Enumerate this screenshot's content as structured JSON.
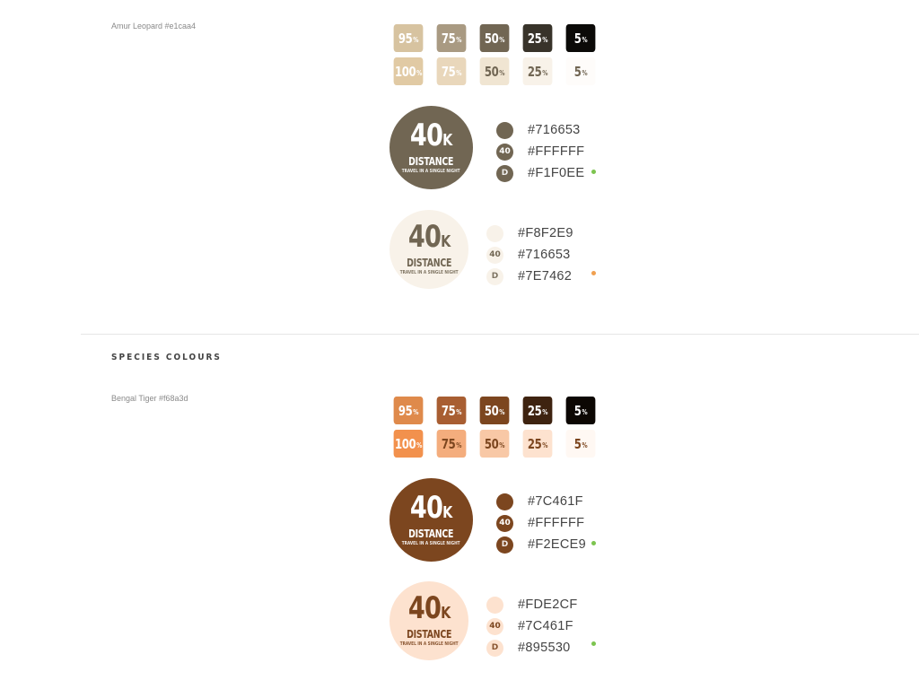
{
  "leopard": {
    "label": "Amur Leopard #e1caa4",
    "dark_swatches": [
      {
        "value": "95",
        "unit": "%",
        "bg": "#d7c3a0",
        "fg": "#ffffff"
      },
      {
        "value": "75",
        "unit": "%",
        "bg": "#a99a82",
        "fg": "#ffffff"
      },
      {
        "value": "50",
        "unit": "%",
        "bg": "#716653",
        "fg": "#ffffff"
      },
      {
        "value": "25",
        "unit": "%",
        "bg": "#38332a",
        "fg": "#ffffff"
      },
      {
        "value": "5",
        "unit": "%",
        "bg": "#0b0a08",
        "fg": "#ffffff"
      }
    ],
    "light_swatches": [
      {
        "value": "100",
        "unit": "%",
        "bg": "#e1caa4",
        "fg": "#ffffff"
      },
      {
        "value": "75",
        "unit": "%",
        "bg": "#e9d7bb",
        "fg": "#ffffff"
      },
      {
        "value": "50",
        "unit": "%",
        "bg": "#f0e5d2",
        "fg": "#716653"
      },
      {
        "value": "25",
        "unit": "%",
        "bg": "#f8f2e9",
        "fg": "#716653"
      },
      {
        "value": "5",
        "unit": "%",
        "bg": "#fefcfa",
        "fg": "#716653"
      }
    ],
    "badge_dark": {
      "number": "40",
      "suffix": "K",
      "title": "DISTANCE",
      "subtitle": "TRAVEL IN A SINGLE NIGHT",
      "bg": "#716653",
      "fg": "#ffffff",
      "sub_fg": "#f1f0ee"
    },
    "legend_dark": [
      {
        "glyph": "",
        "code": "#716653",
        "bg": "#716653",
        "fg": "#ffffff"
      },
      {
        "glyph": "40",
        "code": "#FFFFFF",
        "bg": "#716653",
        "fg": "#ffffff"
      },
      {
        "glyph": "D",
        "code": "#F1F0EE",
        "bg": "#716653",
        "fg": "#f1f0ee"
      }
    ],
    "status_dark": "#7cc44f",
    "badge_light": {
      "number": "40",
      "suffix": "K",
      "title": "DISTANCE",
      "subtitle": "TRAVEL IN A SINGLE NIGHT",
      "bg": "#f8f2e9",
      "fg": "#716653",
      "sub_fg": "#7e7462"
    },
    "legend_light": [
      {
        "glyph": "",
        "code": "#F8F2E9",
        "bg": "#f8f2e9",
        "fg": "#716653"
      },
      {
        "glyph": "40",
        "code": "#716653",
        "bg": "#f8f2e9",
        "fg": "#716653"
      },
      {
        "glyph": "D",
        "code": "#7E7462",
        "bg": "#f8f2e9",
        "fg": "#7e7462"
      }
    ],
    "status_light": "#f0a050"
  },
  "species_title": "SPECIES COLOURS",
  "tiger": {
    "label": "Bengal Tiger #f68a3d",
    "dark_swatches": [
      {
        "value": "95",
        "unit": "%",
        "bg": "#df8a4b",
        "fg": "#ffffff"
      },
      {
        "value": "75",
        "unit": "%",
        "bg": "#a85e32",
        "fg": "#ffffff"
      },
      {
        "value": "50",
        "unit": "%",
        "bg": "#7c461f",
        "fg": "#ffffff"
      },
      {
        "value": "25",
        "unit": "%",
        "bg": "#3e2310",
        "fg": "#ffffff"
      },
      {
        "value": "5",
        "unit": "%",
        "bg": "#0c0703",
        "fg": "#ffffff"
      }
    ],
    "light_swatches": [
      {
        "value": "100",
        "unit": "%",
        "bg": "#f2914d",
        "fg": "#ffffff"
      },
      {
        "value": "75",
        "unit": "%",
        "bg": "#f4ad7d",
        "fg": "#7c461f"
      },
      {
        "value": "50",
        "unit": "%",
        "bg": "#f8c8a6",
        "fg": "#7c461f"
      },
      {
        "value": "25",
        "unit": "%",
        "bg": "#fde2cf",
        "fg": "#7c461f"
      },
      {
        "value": "5",
        "unit": "%",
        "bg": "#fff8f3",
        "fg": "#7c461f"
      }
    ],
    "badge_dark": {
      "number": "40",
      "suffix": "K",
      "title": "DISTANCE",
      "subtitle": "TRAVEL IN A SINGLE NIGHT",
      "bg": "#7c461f",
      "fg": "#ffffff",
      "sub_fg": "#f2ece9"
    },
    "legend_dark": [
      {
        "glyph": "",
        "code": "#7C461F",
        "bg": "#7c461f",
        "fg": "#ffffff"
      },
      {
        "glyph": "40",
        "code": "#FFFFFF",
        "bg": "#7c461f",
        "fg": "#ffffff"
      },
      {
        "glyph": "D",
        "code": "#F2ECE9",
        "bg": "#7c461f",
        "fg": "#f2ece9"
      }
    ],
    "status_dark": "#7cc44f",
    "badge_light": {
      "number": "40",
      "suffix": "K",
      "title": "DISTANCE",
      "subtitle": "TRAVEL IN A SINGLE NIGHT",
      "bg": "#fde2cf",
      "fg": "#7c461f",
      "sub_fg": "#895530"
    },
    "legend_light": [
      {
        "glyph": "",
        "code": "#FDE2CF",
        "bg": "#fde2cf",
        "fg": "#7c461f"
      },
      {
        "glyph": "40",
        "code": "#7C461F",
        "bg": "#fde2cf",
        "fg": "#7c461f"
      },
      {
        "glyph": "D",
        "code": "#895530",
        "bg": "#fde2cf",
        "fg": "#895530"
      }
    ],
    "status_light": "#7cc44f"
  }
}
